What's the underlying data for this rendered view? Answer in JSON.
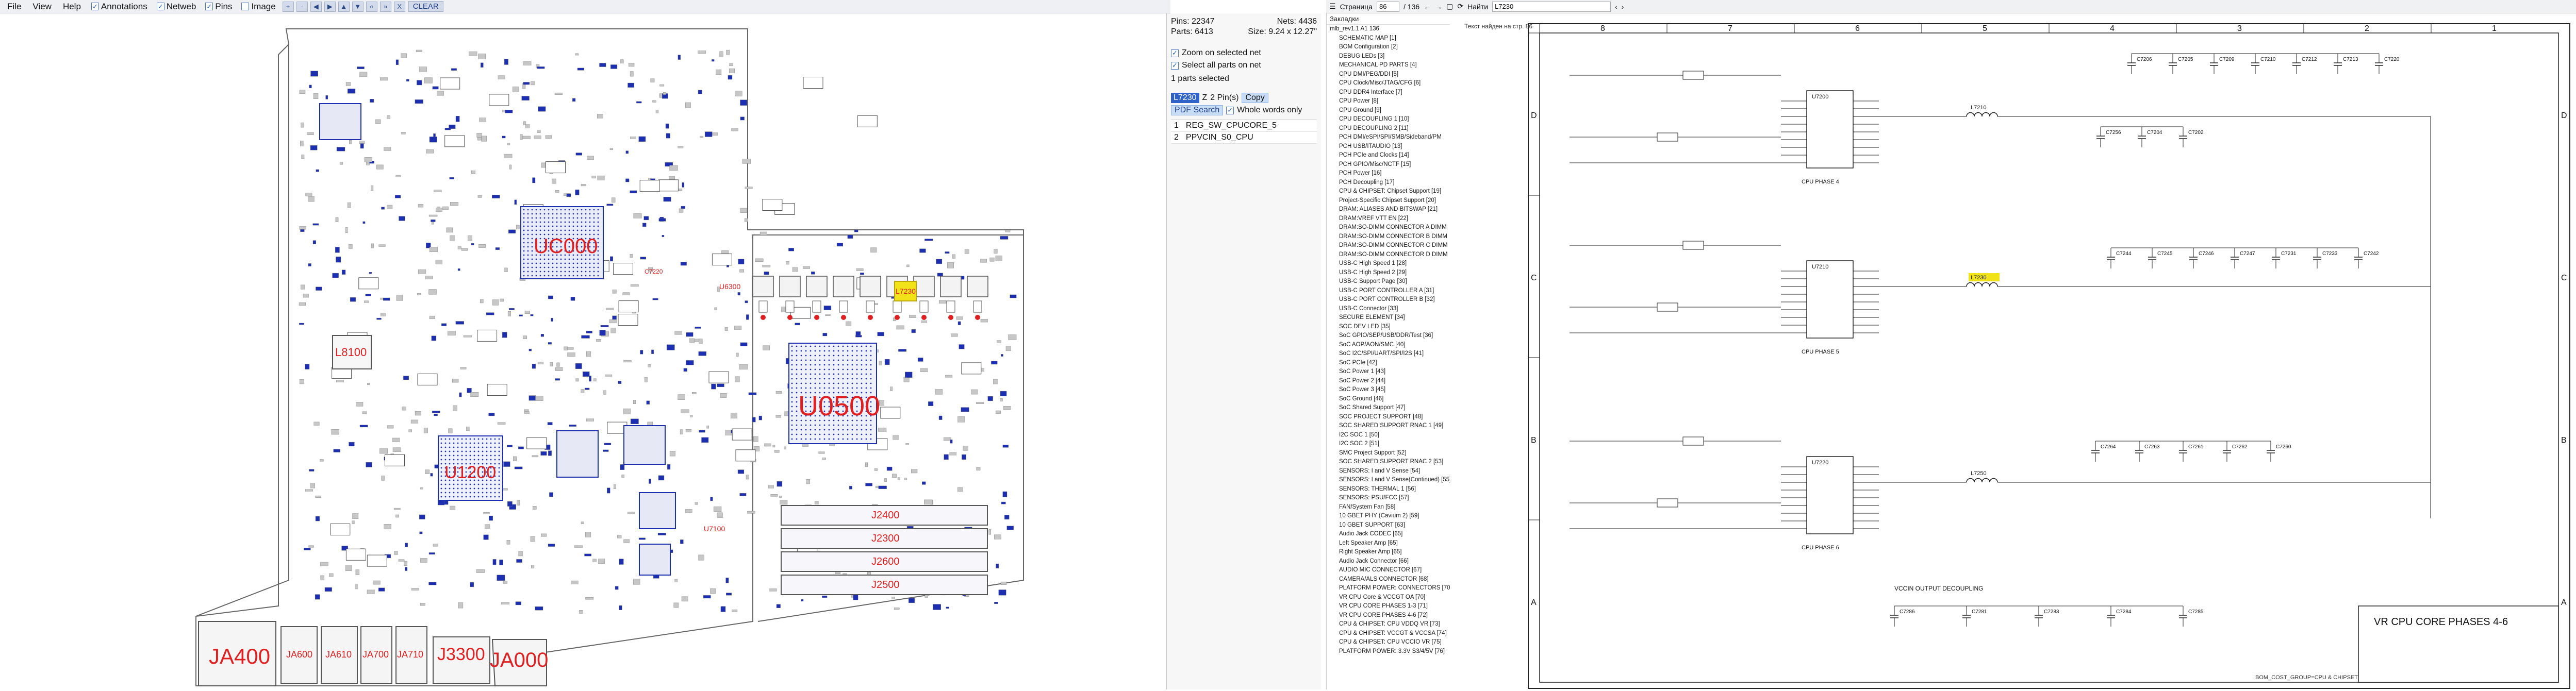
{
  "menu": {
    "file": "File",
    "view": "View",
    "help": "Help",
    "annotations": "Annotations",
    "netweb": "Netweb",
    "pins": "Pins",
    "image": "Image",
    "tool_glyphs": [
      "+",
      "-",
      "◀",
      "▶",
      "▲",
      "▼",
      "«",
      "»"
    ],
    "x_label": "X",
    "clear": "CLEAR"
  },
  "info": {
    "pins_label": "Pins: 22347",
    "parts_label": "Parts: 6413",
    "nets_label": "Nets: 4436",
    "size_label": "Size: 9.24 x 12.27\"",
    "zoom_selected": "Zoom on selected net",
    "select_all": "Select all parts on net",
    "parts_selected": "1 parts selected",
    "part_name": "L7230",
    "z_label": "Z",
    "pins_count": "2 Pin(s)",
    "copy": "Copy",
    "pdf_search": "PDF Search",
    "whole_words": "Whole words only",
    "pin_rows": [
      {
        "num": "1",
        "net": "REG_SW_CPUCORE_5"
      },
      {
        "num": "2",
        "net": "PPVCIN_S0_CPU"
      }
    ]
  },
  "pdf_toolbar": {
    "page_label": "Страница",
    "page_value": "86",
    "page_total": "/ 136",
    "find_label": "Найти",
    "find_value": "L7230",
    "status": "Текст найден на стр. 86"
  },
  "bookmarks": {
    "title": "Закладки",
    "root": "mlb_rev1.1 A1 136",
    "items": [
      "SCHEMATIC MAP [1]",
      "BOM Configuration [2]",
      "DEBUG LEDs [3]",
      "MECHANICAL PD PARTS [4]",
      "CPU DMI/PEG/DDI [5]",
      "CPU Clock/Misc/JTAG/CFG [6]",
      "CPU DDR4 Interface [7]",
      "CPU Power [8]",
      "CPU Ground [9]",
      "CPU DECOUPLING 1 [10]",
      "CPU DECOUPLING 2 [11]",
      "PCH DMI/eSPI/SPI/SMB/Sideband/PM",
      "PCH USB/ITAUDIO [13]",
      "PCH PCIe and Clocks [14]",
      "PCH GPIO/Misc/NCTF [15]",
      "PCH Power [16]",
      "PCH Decoupling [17]",
      "CPU & CHIPSET: Chipset Support [19]",
      "Project-Specific Chipset Support [20]",
      "DRAM: ALIASES AND BITSWAP [21]",
      "DRAM:VREF VTT EN [22]",
      "DRAM:SO-DIMM CONNECTOR A DIMM",
      "DRAM:SO-DIMM CONNECTOR B DIMM",
      "DRAM:SO-DIMM CONNECTOR C DIMM",
      "DRAM:SO-DIMM CONNECTOR D DIMM",
      "USB-C High Speed 1 [28]",
      "USB-C High Speed 2 [29]",
      "USB-C Support Page [30]",
      "USB-C PORT CONTROLLER A [31]",
      "USB-C PORT CONTROLLER B [32]",
      "USB-C Connector [33]",
      "SECURE ELEMENT [34]",
      "SOC DEV LED [35]",
      "SoC GPIO/SEP/USB/DDR/Test [36]",
      "SoC AOP/AON/SMC [40]",
      "SoC I2C/SPI/UART/SPI/I2S [41]",
      "SoC PCIe [42]",
      "SoC Power 1 [43]",
      "SoC Power 2 [44]",
      "SoC Power 3 [45]",
      "SoC Ground [46]",
      "SoC Shared Support [47]",
      "SOC PROJECT SUPPORT [48]",
      "SOC SHARED SUPPORT RNAC 1 [49]",
      "I2C SOC 1 [50]",
      "I2C SOC 2 [51]",
      "SMC Project Support [52]",
      "SOC SHARED SUPPORT RNAC 2 [53]",
      "SENSORS: I and V Sense [54]",
      "SENSORS: I and V Sense(Continued) [55]",
      "SENSORS: THERMAL 1 [56]",
      "SENSORS: PSU/FCC [57]",
      "FAN/System Fan [58]",
      "10 GBET PHY (Cavium 2) [59]",
      "10 GBET SUPPORT [63]",
      "Audio Jack CODEC [65]",
      "Left Speaker Amp [65]",
      "Right Speaker Amp [65]",
      "Audio Jack Connector [66]",
      "AUDIO MIC CONNECTOR [67]",
      "CAMERA/ALS CONNECTOR [68]",
      "PLATFORM POWER: CONNECTORS [70]",
      "VR CPU Core & VCCGT OA [70]",
      "VR CPU CORE PHASES 1-3 [71]",
      "VR CPU CORE PHASES 4-6 [72]",
      "CPU & CHIPSET: CPU VDDQ VR [73]",
      "CPU & CHIPSET: VCCGT & VCCSA [74]",
      "CPU & CHIPSET: CPU VCCIO VR [75]",
      "PLATFORM POWER: 3.3V S3/4/5V [76]"
    ]
  },
  "board": {
    "labels": {
      "uc000": "UC000",
      "u0500": "U0500",
      "ja400": "JA400",
      "ja000": "JA000",
      "j3300": "J3300",
      "ja600": "JA600",
      "ja610": "JA610",
      "ja700": "JA700",
      "ja710": "JA710",
      "l8100": "L8100",
      "u1200": "U1200",
      "j2400": "J2400",
      "j2300": "J2300",
      "j2600": "J2600",
      "j2500": "J2500",
      "l7230": "L7230",
      "u6300": "U6300",
      "c7220": "C7220",
      "u7100": "U7100"
    }
  },
  "schematic": {
    "col_numbers": [
      "8",
      "7",
      "6",
      "5",
      "4",
      "3",
      "2",
      "1"
    ],
    "row_letters": [
      "D",
      "C",
      "B",
      "A"
    ],
    "title": "VR CPU CORE PHASES 4-6",
    "phase_labels": [
      "CPU PHASE 4",
      "CPU PHASE 5",
      "CPU PHASE 6"
    ],
    "output_label": "VCCIN OUTPUT DECOUPLING",
    "ic_labels": [
      "U7200",
      "U7210",
      "U7220"
    ],
    "inductor_labels": [
      "L7210",
      "L7230",
      "L7250"
    ],
    "highlight_label": "L7230",
    "bottom_note": "BOM_COST_GROUP=CPU & CHIPSET",
    "cap_row_d": [
      "C7206",
      "C7205",
      "C7209",
      "C7210",
      "C7212",
      "C7213",
      "C7220"
    ],
    "cap_row_d2": [
      "C7256",
      "C7204",
      "C7202"
    ],
    "cap_row_c": [
      "C7244",
      "C7245",
      "C7246",
      "C7247",
      "C7231",
      "C7233",
      "C7242"
    ],
    "cap_row_b": [
      "C7264",
      "C7263",
      "C7261",
      "C7262",
      "C7260"
    ],
    "cap_row_a": [
      "C7286",
      "C7281",
      "C7283",
      "C7284",
      "C7285"
    ]
  },
  "colors": {
    "board_outline": "#555555",
    "part_red": "#e02020",
    "pad_blue": "#1b2fb0",
    "highlight": "#f2e21a",
    "selection": "#2f62c9"
  }
}
